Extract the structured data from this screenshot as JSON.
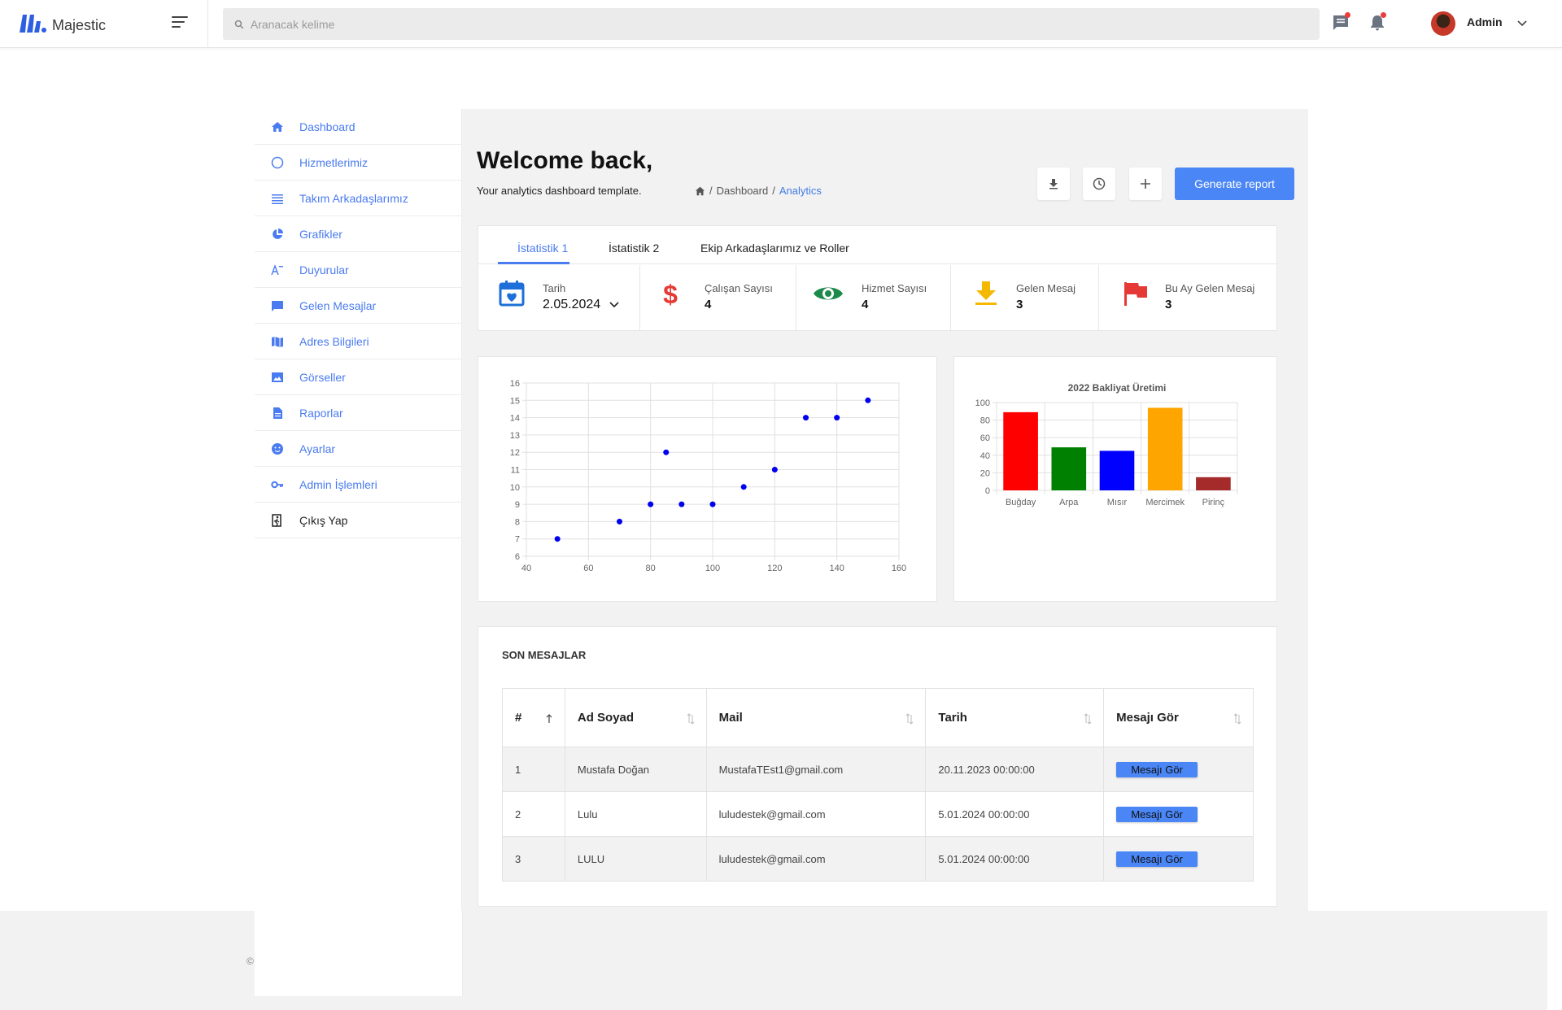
{
  "navbar": {
    "brand": "Majestic",
    "search_placeholder": "Aranacak kelime",
    "user_name": "Admin"
  },
  "sidebar": {
    "items": [
      {
        "label": "Dashboard",
        "icon": "home-icon"
      },
      {
        "label": "Hizmetlerimiz",
        "icon": "circle-icon"
      },
      {
        "label": "Takım Arkadaşlarımız",
        "icon": "list-icon"
      },
      {
        "label": "Grafikler",
        "icon": "pie-chart-icon"
      },
      {
        "label": "Duyurular",
        "icon": "text-icon"
      },
      {
        "label": "Gelen Mesajlar",
        "icon": "chat-icon"
      },
      {
        "label": "Adres Bilgileri",
        "icon": "map-icon"
      },
      {
        "label": "Görseller",
        "icon": "image-icon"
      },
      {
        "label": "Raporlar",
        "icon": "document-icon"
      },
      {
        "label": "Ayarlar",
        "icon": "smiley-icon"
      },
      {
        "label": "Admin İşlemleri",
        "icon": "key-icon"
      },
      {
        "label": "Çıkış Yap",
        "icon": "exit-icon"
      }
    ]
  },
  "header": {
    "title": "Welcome back,",
    "subtitle": "Your analytics dashboard template.",
    "breadcrumb": [
      "Dashboard",
      "Analytics"
    ],
    "report_button": "Generate report"
  },
  "tabs": [
    "İstatistik 1",
    "İstatistik 2",
    "Ekip Arkadaşlarımız ve Roller"
  ],
  "stats": [
    {
      "label": "Tarih",
      "value": "2.05.2024",
      "icon": "calendar-icon",
      "color": "#1e6fd9"
    },
    {
      "label": "Çalışan Sayısı",
      "value": "4",
      "icon": "dollar-icon",
      "color": "#e53935"
    },
    {
      "label": "Hizmet Sayısı",
      "value": "4",
      "icon": "eye-icon",
      "color": "#1b8a4a"
    },
    {
      "label": "Gelen Mesaj",
      "value": "3",
      "icon": "download-icon",
      "color": "#f5b800"
    },
    {
      "label": "Bu Ay Gelen Mesaj",
      "value": "3",
      "icon": "flag-icon",
      "color": "#e53935"
    }
  ],
  "chart_data": [
    {
      "type": "scatter",
      "title": "",
      "xlabel": "",
      "ylabel": "",
      "xlim": [
        40,
        160
      ],
      "ylim": [
        6,
        16
      ],
      "x_ticks": [
        40,
        60,
        80,
        100,
        120,
        140,
        160
      ],
      "y_ticks": [
        6,
        7,
        8,
        9,
        10,
        11,
        12,
        13,
        14,
        15,
        16
      ],
      "grid": true,
      "color": "#0000ee",
      "points": [
        {
          "x": 50,
          "y": 7
        },
        {
          "x": 70,
          "y": 8
        },
        {
          "x": 80,
          "y": 9
        },
        {
          "x": 85,
          "y": 12
        },
        {
          "x": 90,
          "y": 9
        },
        {
          "x": 100,
          "y": 9
        },
        {
          "x": 110,
          "y": 10
        },
        {
          "x": 120,
          "y": 11
        },
        {
          "x": 130,
          "y": 14
        },
        {
          "x": 140,
          "y": 14
        },
        {
          "x": 150,
          "y": 15
        }
      ]
    },
    {
      "type": "bar",
      "title": "2022 Bakliyat Üretimi",
      "xlabel": "",
      "ylabel": "",
      "ylim": [
        0,
        100
      ],
      "y_ticks": [
        0,
        20,
        40,
        60,
        80,
        100
      ],
      "grid": true,
      "categories": [
        "Buğday",
        "Arpa",
        "Mısır",
        "Mercimek",
        "Pirinç"
      ],
      "values": [
        89,
        49,
        45,
        94,
        15
      ],
      "colors": [
        "#ff0000",
        "#008000",
        "#0000ff",
        "#ffa500",
        "#a52a2a"
      ]
    }
  ],
  "messages": {
    "title": "SON MESAJLAR",
    "columns": [
      "#",
      "Ad Soyad",
      "Mail",
      "Tarih",
      "Mesajı Gör"
    ],
    "rows": [
      {
        "no": "1",
        "name": "Mustafa Doğan",
        "mail": "MustafaTEst1@gmail.com",
        "date": "20.11.2023 00:00:00",
        "action": "Mesajı Gör"
      },
      {
        "no": "2",
        "name": "Lulu",
        "mail": "luludestek@gmail.com",
        "date": "5.01.2024 00:00:00",
        "action": "Mesajı Gör"
      },
      {
        "no": "3",
        "name": "LULU",
        "mail": "luludestek@gmail.com",
        "date": "5.01.2024 00:00:00",
        "action": "Mesajı Gör"
      }
    ]
  },
  "footer": {
    "copyright": "©"
  }
}
